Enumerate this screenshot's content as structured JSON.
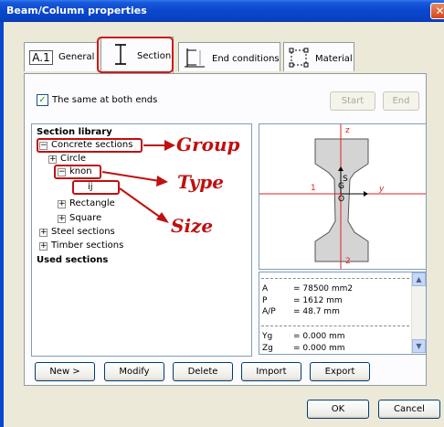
{
  "window": {
    "title": "Beam/Column properties",
    "close_glyph": "✕"
  },
  "tabs": [
    {
      "label": "General",
      "icon": "a1-icon",
      "icon_text": "A.1"
    },
    {
      "label": "Section",
      "icon": "i-beam-icon"
    },
    {
      "label": "End conditions",
      "icon": "end-condition-icon"
    },
    {
      "label": "Material",
      "icon": "material-grid-icon"
    }
  ],
  "same_at_both_ends": {
    "label": "The same at both ends",
    "checked": true,
    "check_glyph": "✓"
  },
  "end_buttons": {
    "start": "Start",
    "end": "End"
  },
  "library": {
    "heading": "Section library",
    "items": [
      {
        "label": "Concrete sections",
        "expander": "−"
      },
      {
        "label": "Circle",
        "expander": "+"
      },
      {
        "label": "knon",
        "expander": "−"
      },
      {
        "label": "ij"
      },
      {
        "label": "Rectangle",
        "expander": "+"
      },
      {
        "label": "Square",
        "expander": "+"
      },
      {
        "label": "Steel sections",
        "expander": "+"
      },
      {
        "label": "Timber sections",
        "expander": "+"
      }
    ],
    "used_heading": "Used sections"
  },
  "preview": {
    "axis_z_top": "z",
    "axis_y": "y",
    "label_1": "1",
    "label_2": "2",
    "label_S": "S",
    "label_G": "G",
    "label_O": "O",
    "axis_color": "#e02020",
    "section_fill": "#d4d4d4"
  },
  "properties": [
    {
      "name": "A",
      "value": "= 78500 mm2"
    },
    {
      "name": "P",
      "value": "= 1612 mm"
    },
    {
      "name": "A/P",
      "value": "= 48.7 mm"
    },
    {
      "name": "Yg",
      "value": "= 0.000 mm"
    },
    {
      "name": "Zg",
      "value": "= 0.000 mm"
    }
  ],
  "actions": {
    "new": "New >",
    "modify": "Modify",
    "delete": "Delete",
    "import": "Import",
    "export": "Export"
  },
  "dialog": {
    "ok": "OK",
    "cancel": "Cancel"
  },
  "annotations": {
    "group": "Group",
    "type": "Type",
    "size": "Size",
    "color": "#c01010"
  }
}
